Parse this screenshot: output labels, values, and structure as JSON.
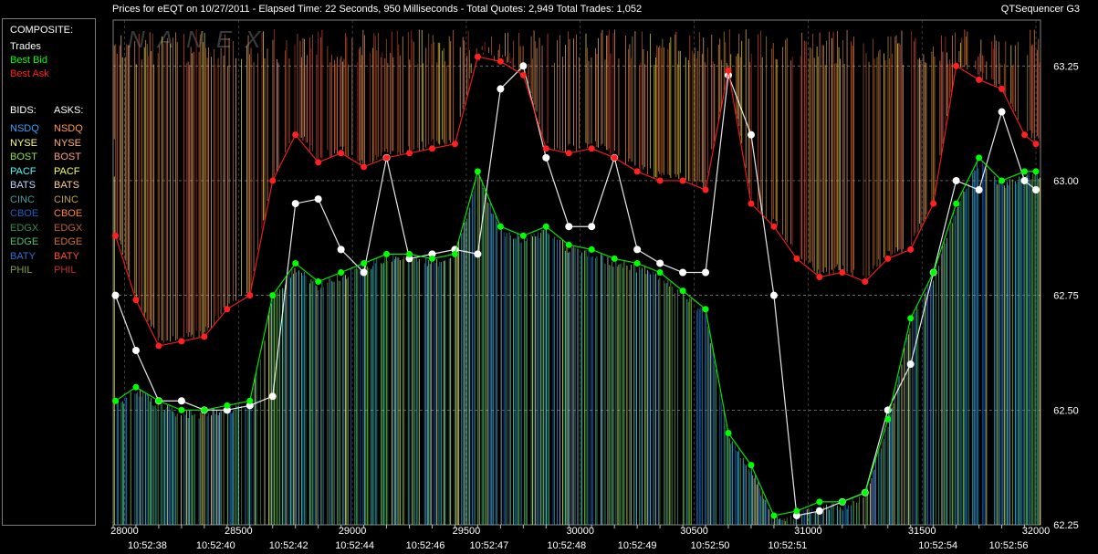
{
  "window": {
    "title": "Prices for  eEQT  on  10/27/2011  -  Elapsed Time: 22 Seconds, 950 Milliseconds  -  Total Quotes: 2,949  Total Trades: 1,052",
    "app_name": "QTSequencer G3",
    "watermark": "NANEX"
  },
  "legend": {
    "composite_header": "COMPOSITE:",
    "composite": [
      {
        "label": "Trades",
        "color": "#ffffff"
      },
      {
        "label": "Best Bid",
        "color": "#00ff00"
      },
      {
        "label": "Best Ask",
        "color": "#ff2020"
      }
    ],
    "bids_header": "BIDS:",
    "asks_header": "ASKS:",
    "exchanges": [
      {
        "bid": "NSDQ",
        "ask": "NSDQ",
        "bid_color": "#3aa0ff",
        "ask_color": "#ff9a40"
      },
      {
        "bid": "NYSE",
        "ask": "NYSE",
        "bid_color": "#ffff80",
        "ask_color": "#ffb070"
      },
      {
        "bid": "BOST",
        "ask": "BOST",
        "bid_color": "#90e040",
        "ask_color": "#ff9a80"
      },
      {
        "bid": "PACF",
        "ask": "PACF",
        "bid_color": "#40ffff",
        "ask_color": "#ffff40"
      },
      {
        "bid": "BATS",
        "ask": "BATS",
        "bid_color": "#c0d8ff",
        "ask_color": "#ffd090"
      },
      {
        "bid": "CINC",
        "ask": "CINC",
        "bid_color": "#3fa0a0",
        "ask_color": "#c0a040"
      },
      {
        "bid": "CBOE",
        "ask": "CBOE",
        "bid_color": "#2060c0",
        "ask_color": "#ff8040"
      },
      {
        "bid": "EDGX",
        "ask": "EDGX",
        "bid_color": "#309050",
        "ask_color": "#c06030"
      },
      {
        "bid": "EDGE",
        "ask": "EDGE",
        "bid_color": "#50c070",
        "ask_color": "#d07030"
      },
      {
        "bid": "BATY",
        "ask": "BATY",
        "bid_color": "#3070d0",
        "ask_color": "#ff5030"
      },
      {
        "bid": "PHIL",
        "ask": "PHIL",
        "bid_color": "#80a040",
        "ask_color": "#c03030"
      }
    ]
  },
  "chart_data": {
    "type": "line",
    "title": "Prices for  eEQT  on  10/27/2011",
    "xlabel": "",
    "ylabel": "",
    "xlim": [
      27950,
      32020
    ],
    "ylim": [
      62.25,
      63.35
    ],
    "x_ticks": [
      28000,
      28500,
      29000,
      29500,
      30000,
      30500,
      31000,
      31500,
      32000
    ],
    "y_ticks": [
      62.25,
      62.5,
      62.75,
      63.0,
      63.25
    ],
    "y_tick_labels": [
      "62.25",
      "62.50",
      "62.75",
      "63.00",
      "63.25"
    ],
    "time_labels": [
      {
        "x": 28100,
        "label": "10:52:38"
      },
      {
        "x": 28400,
        "label": "10:52:40"
      },
      {
        "x": 28720,
        "label": "10:52:42"
      },
      {
        "x": 29010,
        "label": "10:52:44"
      },
      {
        "x": 29320,
        "label": "10:52:46"
      },
      {
        "x": 29600,
        "label": "10:52:47"
      },
      {
        "x": 29940,
        "label": "10:52:48"
      },
      {
        "x": 30250,
        "label": "10:52:49"
      },
      {
        "x": 30570,
        "label": "10:52:50"
      },
      {
        "x": 30910,
        "label": "10:52:51"
      },
      {
        "x": 31570,
        "label": "10:52:54"
      },
      {
        "x": 31880,
        "label": "10:52:56"
      }
    ],
    "grid": true,
    "legend_position": "left-panel",
    "series": [
      {
        "name": "Trades",
        "color": "#ffffff",
        "x": [
          27960,
          28050,
          28150,
          28250,
          28350,
          28450,
          28550,
          28650,
          28750,
          28850,
          28950,
          29050,
          29150,
          29250,
          29350,
          29450,
          29550,
          29650,
          29750,
          29850,
          29950,
          30050,
          30150,
          30250,
          30350,
          30450,
          30550,
          30650,
          30750,
          30850,
          30950,
          31050,
          31150,
          31250,
          31350,
          31450,
          31550,
          31650,
          31750,
          31850,
          31950,
          32000
        ],
        "y": [
          62.75,
          62.63,
          62.52,
          62.52,
          62.5,
          62.5,
          62.51,
          62.53,
          62.95,
          62.96,
          62.85,
          62.8,
          63.05,
          62.83,
          62.84,
          62.85,
          62.84,
          63.2,
          63.25,
          63.05,
          62.9,
          62.9,
          63.05,
          62.85,
          62.82,
          62.8,
          62.8,
          63.23,
          63.1,
          62.75,
          62.27,
          62.28,
          62.3,
          62.32,
          62.5,
          62.6,
          62.8,
          63.0,
          62.98,
          63.15,
          63.0,
          62.98
        ]
      },
      {
        "name": "Best Bid",
        "color": "#00ff00",
        "x": [
          27960,
          28050,
          28150,
          28250,
          28350,
          28450,
          28550,
          28650,
          28750,
          28850,
          28950,
          29050,
          29150,
          29250,
          29350,
          29450,
          29550,
          29650,
          29750,
          29850,
          29950,
          30050,
          30150,
          30250,
          30350,
          30450,
          30550,
          30650,
          30750,
          30850,
          30950,
          31050,
          31150,
          31250,
          31350,
          31450,
          31550,
          31650,
          31750,
          31850,
          31950,
          32000
        ],
        "y": [
          62.52,
          62.55,
          62.52,
          62.5,
          62.5,
          62.51,
          62.52,
          62.75,
          62.82,
          62.78,
          62.8,
          62.82,
          62.84,
          62.84,
          62.83,
          62.84,
          63.02,
          62.9,
          62.88,
          62.9,
          62.86,
          62.85,
          62.83,
          62.82,
          62.8,
          62.76,
          62.72,
          62.45,
          62.38,
          62.27,
          62.28,
          62.3,
          62.3,
          62.32,
          62.48,
          62.7,
          62.8,
          62.95,
          63.05,
          63.0,
          63.02,
          63.02
        ]
      },
      {
        "name": "Best Ask",
        "color": "#ff2020",
        "x": [
          27960,
          28050,
          28150,
          28250,
          28350,
          28450,
          28550,
          28650,
          28750,
          28850,
          28950,
          29050,
          29150,
          29250,
          29350,
          29450,
          29550,
          29650,
          29750,
          29850,
          29950,
          30050,
          30150,
          30250,
          30350,
          30450,
          30550,
          30650,
          30750,
          30850,
          30950,
          31050,
          31150,
          31250,
          31350,
          31450,
          31550,
          31650,
          31750,
          31850,
          31950,
          32000
        ],
        "y": [
          62.88,
          62.74,
          62.64,
          62.65,
          62.66,
          62.72,
          62.75,
          63.0,
          63.1,
          63.04,
          63.06,
          63.03,
          63.05,
          63.06,
          63.07,
          63.08,
          63.27,
          63.26,
          63.23,
          63.07,
          63.06,
          63.07,
          63.05,
          63.02,
          63.0,
          63.0,
          62.98,
          63.24,
          62.95,
          62.9,
          62.83,
          62.79,
          62.8,
          62.78,
          62.83,
          62.85,
          62.95,
          63.25,
          63.22,
          63.2,
          63.1,
          63.08
        ]
      }
    ]
  }
}
